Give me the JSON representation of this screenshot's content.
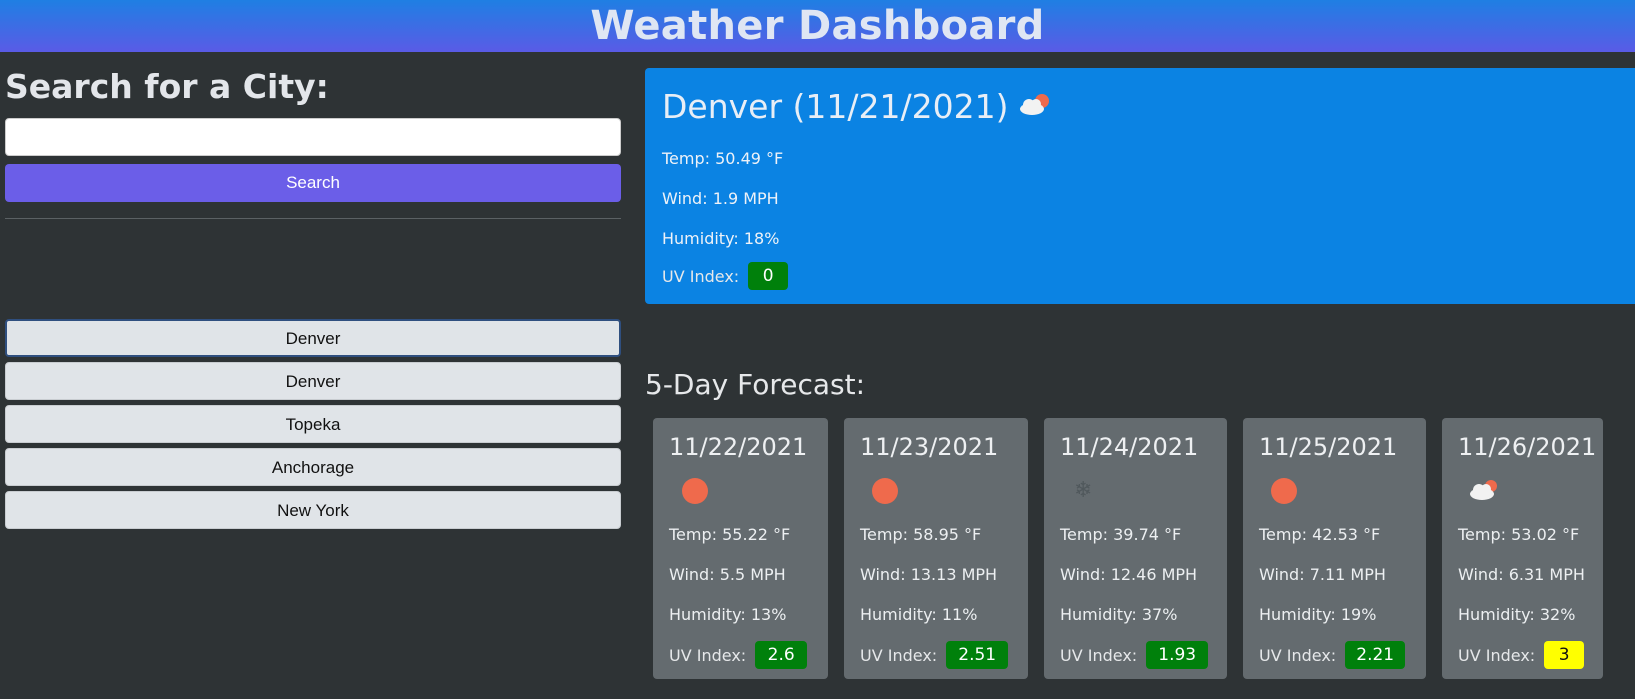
{
  "header": {
    "title": "Weather Dashboard"
  },
  "search": {
    "heading": "Search for a City:",
    "input_value": "",
    "placeholder": "",
    "button_label": "Search"
  },
  "history": [
    "Denver",
    "Denver",
    "Topeka",
    "Anchorage",
    "New York"
  ],
  "current": {
    "city_date": "Denver (11/21/2021)",
    "icon": "cloud-sun-icon",
    "temp": "Temp: 50.49 °F",
    "wind": "Wind: 1.9 MPH",
    "humidity": "Humidity: 18%",
    "uv_label": "UV Index:",
    "uv_value": "0",
    "uv_color": "#00800b"
  },
  "forecast": {
    "title": "5-Day Forecast:",
    "days": [
      {
        "date": "11/22/2021",
        "icon": "sun-icon",
        "temp": "Temp: 55.22 °F",
        "wind": "Wind: 5.5 MPH",
        "humidity": "Humidity: 13%",
        "uv_label": "UV Index:",
        "uv_value": "2.6",
        "uv_color": "#00800b"
      },
      {
        "date": "11/23/2021",
        "icon": "sun-icon",
        "temp": "Temp: 58.95 °F",
        "wind": "Wind: 13.13 MPH",
        "humidity": "Humidity: 11%",
        "uv_label": "UV Index:",
        "uv_value": "2.51",
        "uv_color": "#00800b"
      },
      {
        "date": "11/24/2021",
        "icon": "snowflake-icon",
        "temp": "Temp: 39.74 °F",
        "wind": "Wind: 12.46 MPH",
        "humidity": "Humidity: 37%",
        "uv_label": "UV Index:",
        "uv_value": "1.93",
        "uv_color": "#00800b"
      },
      {
        "date": "11/25/2021",
        "icon": "sun-icon",
        "temp": "Temp: 42.53 °F",
        "wind": "Wind: 7.11 MPH",
        "humidity": "Humidity: 19%",
        "uv_label": "UV Index:",
        "uv_value": "2.21",
        "uv_color": "#00800b"
      },
      {
        "date": "11/26/2021",
        "icon": "cloud-sun-icon",
        "temp": "Temp: 53.02 °F",
        "wind": "Wind: 6.31 MPH",
        "humidity": "Humidity: 32%",
        "uv_label": "UV Index:",
        "uv_value": "3",
        "uv_color": "#ffff00"
      }
    ]
  },
  "colors": {
    "header_gradient_top": "#1f7fe3",
    "header_gradient_bottom": "#5a5be6",
    "background": "#2e3335",
    "search_button": "#6b5ee8",
    "current_card": "#0b83e3",
    "forecast_card": "#646b6f",
    "uv_green": "#00800b",
    "uv_yellow": "#ffff00"
  }
}
